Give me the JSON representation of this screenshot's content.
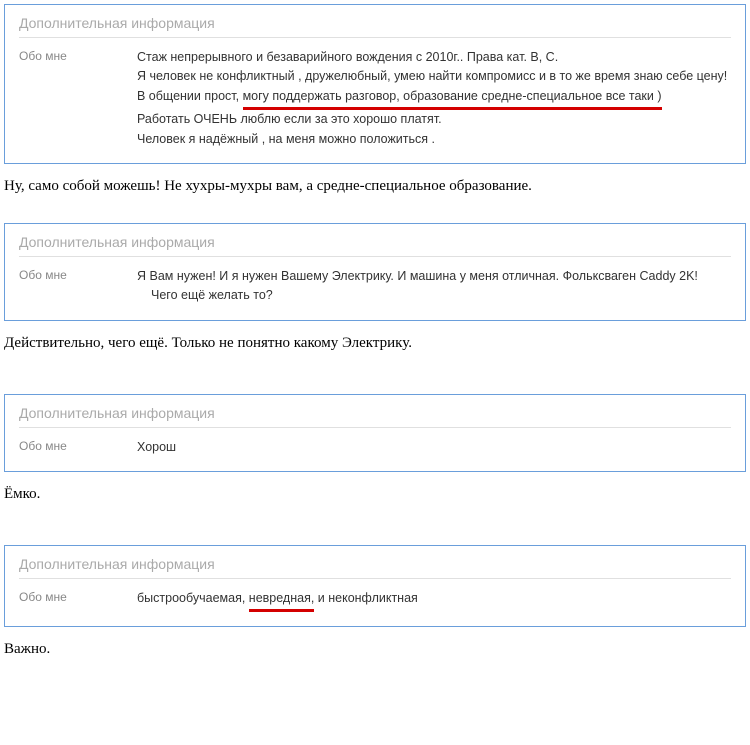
{
  "labels": {
    "section_title": "Дополнительная информация",
    "about_me": "Обо мне"
  },
  "cards": [
    {
      "lines": [
        {
          "text": "Стаж непрерывного и безаварийного вождения с 2010г.. Права кат. В, С."
        },
        {
          "text": "Я человек не конфликтный , дружелюбный, умею найти компромисс и в то же время знаю себе цену!"
        },
        {
          "prefix": "В общении прост, ",
          "underlined": "могу поддержать разговор, образование средне-специальное все таки )"
        },
        {
          "text": "Работать ОЧЕНЬ люблю если за это хорошо платят."
        },
        {
          "text": "Человек я надёжный , на меня можно положиться ."
        }
      ]
    },
    {
      "lines": [
        {
          "text": "Я Вам нужен! И я нужен Вашему Электрику. И машина у меня отличная. Фольксваген Caddy 2K!"
        },
        {
          "text": "Чего ещё желать то?",
          "indent": true
        }
      ]
    },
    {
      "lines": [
        {
          "text": "Хорош"
        }
      ]
    },
    {
      "lines": [
        {
          "prefix": "быстрообучаемая, ",
          "underlined": "невредная,",
          "suffix": " и неконфликтная"
        }
      ]
    }
  ],
  "comments": [
    "Ну, само собой можешь! Не хухры-мухры вам, а средне-специальное образование.",
    "Действительно, чего ещё. Только не понятно какому Электрику.",
    "Ёмко.",
    "Важно."
  ]
}
